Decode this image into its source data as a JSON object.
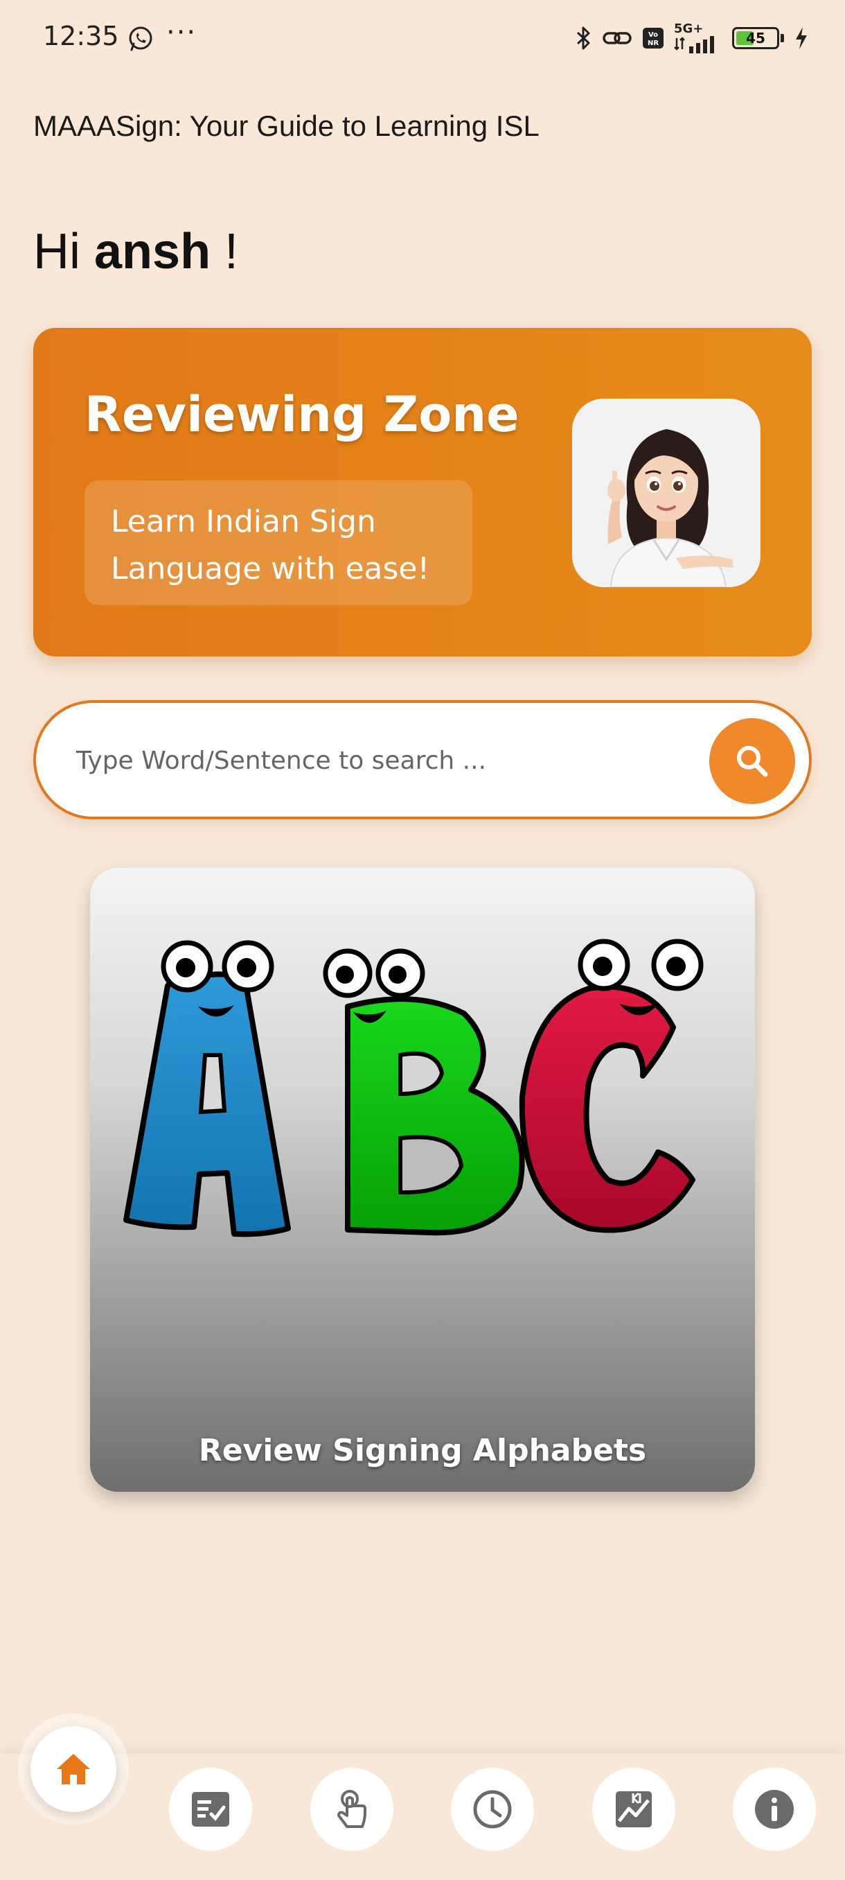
{
  "status_bar": {
    "time": "12:35",
    "network": "5G+",
    "battery": "45",
    "battery_level": 0.45
  },
  "app_title": "MAAASign: Your Guide to Learning ISL",
  "greeting": {
    "prefix": "Hi ",
    "name": "ansh",
    "suffix": " !"
  },
  "banner": {
    "title": "Reviewing Zone",
    "subtitle": "Learn Indian Sign Language with ease!",
    "background": "#e47f19"
  },
  "search": {
    "placeholder": "Type Word/Sentence to search ...",
    "value": "",
    "button_icon": "search-icon",
    "accent": "#f0892c"
  },
  "review_card": {
    "caption": "Review Signing Alphabets",
    "letters": [
      "A",
      "B",
      "C"
    ]
  },
  "bottom_nav": {
    "active": "home",
    "accent": "#e87817",
    "items": [
      "home-icon",
      "checklist-icon",
      "tap-gesture-icon",
      "history-clock-icon",
      "stats-chart-icon",
      "info-icon"
    ]
  }
}
